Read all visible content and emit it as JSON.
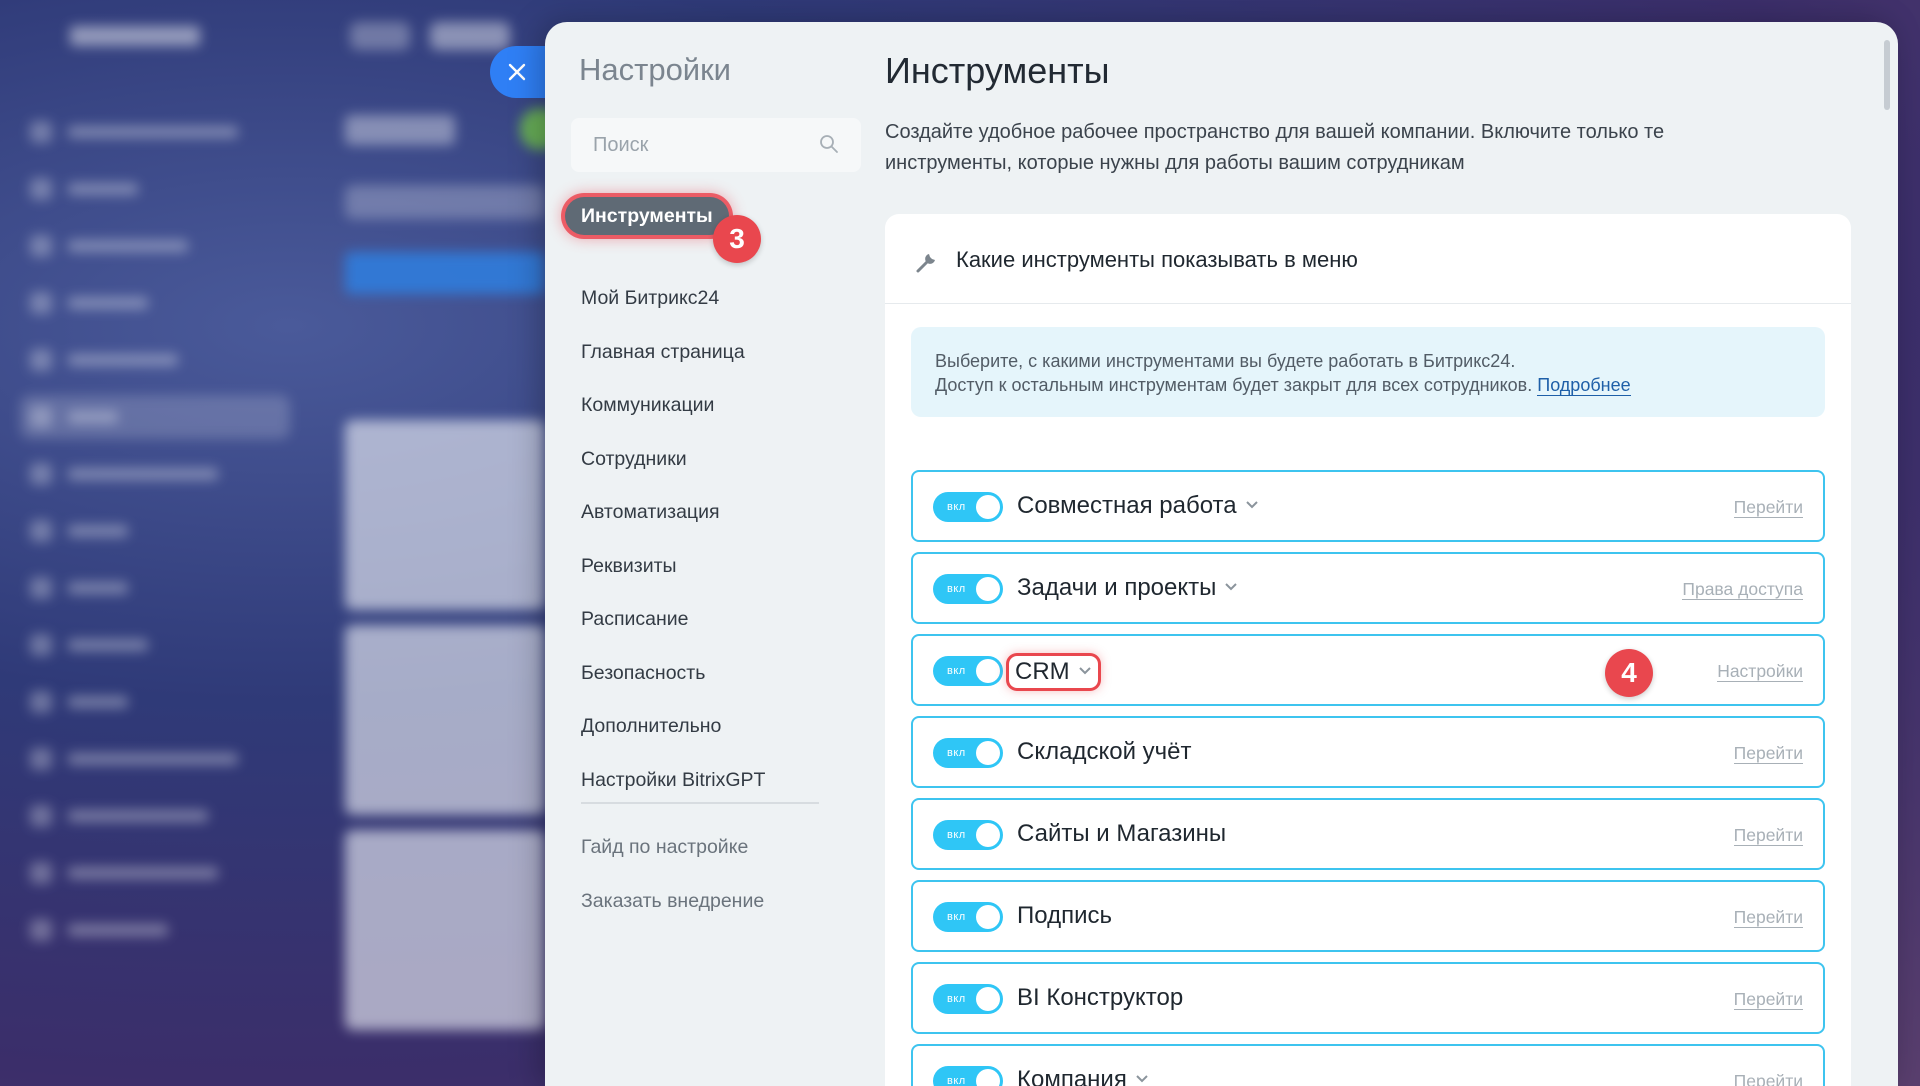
{
  "settings": {
    "title": "Настройки",
    "search_placeholder": "Поиск",
    "nav": [
      {
        "label": "Инструменты"
      },
      {
        "label": "Мой Битрикс24"
      },
      {
        "label": "Главная страница"
      },
      {
        "label": "Коммуникации"
      },
      {
        "label": "Сотрудники"
      },
      {
        "label": "Автоматизация"
      },
      {
        "label": "Реквизиты"
      },
      {
        "label": "Расписание"
      },
      {
        "label": "Безопасность"
      },
      {
        "label": "Дополнительно"
      },
      {
        "label": "Настройки BitrixGPT"
      }
    ],
    "footer_links": [
      {
        "label": "Гайд по настройке"
      },
      {
        "label": "Заказать внедрение"
      }
    ]
  },
  "content": {
    "title": "Инструменты",
    "description": "Создайте удобное рабочее пространство для вашей компании. Включите только те инструменты, которые нужны для работы вашим сотрудникам",
    "card_title": "Какие инструменты показывать в меню",
    "info_line1": "Выберите, с какими инструментами вы будете работать в Битрикс24.",
    "info_line2": "Доступ к остальным инструментам будет закрыт для всех сотрудников.",
    "info_link": "Подробнее",
    "tools": [
      {
        "name": "Совместная работа",
        "toggle": "вкл",
        "link": "Перейти"
      },
      {
        "name": "Задачи и проекты",
        "toggle": "вкл",
        "link": "Права доступа"
      },
      {
        "name": "CRM",
        "toggle": "вкл",
        "link": "Настройки"
      },
      {
        "name": "Складской учёт",
        "toggle": "вкл",
        "link": "Перейти"
      },
      {
        "name": "Сайты и Магазины",
        "toggle": "вкл",
        "link": "Перейти"
      },
      {
        "name": "Подпись",
        "toggle": "вкл",
        "link": "Перейти"
      },
      {
        "name": "BI Конструктор",
        "toggle": "вкл",
        "link": "Перейти"
      },
      {
        "name": "Компания",
        "toggle": "вкл",
        "link": "Перейти"
      }
    ]
  },
  "badges": {
    "nav_step": "3",
    "crm_step": "4"
  },
  "colors": {
    "accent": "#2fc6f6",
    "badge": "#e9474e",
    "close_button": "#2f7ff5"
  }
}
